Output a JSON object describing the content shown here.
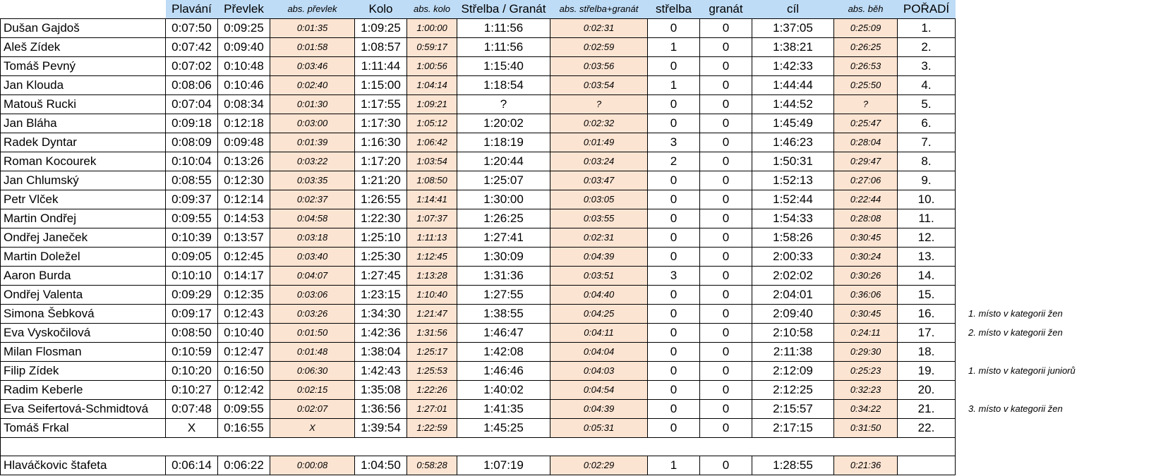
{
  "headers": [
    "",
    "Plavání",
    "Převlek",
    "abs. převlek",
    "Kolo",
    "abs. kolo",
    "Střelba / Granát",
    "abs. střelba+granát",
    "střelba",
    "granát",
    "cíl",
    "abs. běh",
    "POŘADÍ"
  ],
  "rows": [
    {
      "cells": [
        "Dušan Gajdoš",
        "0:07:50",
        "0:09:25",
        "0:01:35",
        "1:09:25",
        "1:00:00",
        "1:11:56",
        "0:02:31",
        "0",
        "0",
        "1:37:05",
        "0:25:09",
        "1."
      ],
      "note": ""
    },
    {
      "cells": [
        "Aleš Zídek",
        "0:07:42",
        "0:09:40",
        "0:01:58",
        "1:08:57",
        "0:59:17",
        "1:11:56",
        "0:02:59",
        "1",
        "0",
        "1:38:21",
        "0:26:25",
        "2."
      ],
      "note": ""
    },
    {
      "cells": [
        "Tomáš Pevný",
        "0:07:02",
        "0:10:48",
        "0:03:46",
        "1:11:44",
        "1:00:56",
        "1:15:40",
        "0:03:56",
        "0",
        "0",
        "1:42:33",
        "0:26:53",
        "3."
      ],
      "note": ""
    },
    {
      "cells": [
        "Jan Klouda",
        "0:08:06",
        "0:10:46",
        "0:02:40",
        "1:15:00",
        "1:04:14",
        "1:18:54",
        "0:03:54",
        "1",
        "0",
        "1:44:44",
        "0:25:50",
        "4."
      ],
      "note": ""
    },
    {
      "cells": [
        "Matouš Rucki",
        "0:07:04",
        "0:08:34",
        "0:01:30",
        "1:17:55",
        "1:09:21",
        "?",
        "?",
        "0",
        "0",
        "1:44:52",
        "?",
        "5."
      ],
      "note": ""
    },
    {
      "cells": [
        "Jan Bláha",
        "0:09:18",
        "0:12:18",
        "0:03:00",
        "1:17:30",
        "1:05:12",
        "1:20:02",
        "0:02:32",
        "0",
        "0",
        "1:45:49",
        "0:25:47",
        "6."
      ],
      "note": ""
    },
    {
      "cells": [
        "Radek Dyntar",
        "0:08:09",
        "0:09:48",
        "0:01:39",
        "1:16:30",
        "1:06:42",
        "1:18:19",
        "0:01:49",
        "3",
        "0",
        "1:46:23",
        "0:28:04",
        "7."
      ],
      "note": ""
    },
    {
      "cells": [
        "Roman Kocourek",
        "0:10:04",
        "0:13:26",
        "0:03:22",
        "1:17:20",
        "1:03:54",
        "1:20:44",
        "0:03:24",
        "2",
        "0",
        "1:50:31",
        "0:29:47",
        "8."
      ],
      "note": ""
    },
    {
      "cells": [
        "Jan Chlumský",
        "0:08:55",
        "0:12:30",
        "0:03:35",
        "1:21:20",
        "1:08:50",
        "1:25:07",
        "0:03:47",
        "0",
        "0",
        "1:52:13",
        "0:27:06",
        "9."
      ],
      "note": ""
    },
    {
      "cells": [
        "Petr Vlček",
        "0:09:37",
        "0:12:14",
        "0:02:37",
        "1:26:55",
        "1:14:41",
        "1:30:00",
        "0:03:05",
        "0",
        "0",
        "1:52:44",
        "0:22:44",
        "10."
      ],
      "note": ""
    },
    {
      "cells": [
        "Martin Ondřej",
        "0:09:55",
        "0:14:53",
        "0:04:58",
        "1:22:30",
        "1:07:37",
        "1:26:25",
        "0:03:55",
        "0",
        "0",
        "1:54:33",
        "0:28:08",
        "11."
      ],
      "note": ""
    },
    {
      "cells": [
        "Ondřej Janeček",
        "0:10:39",
        "0:13:57",
        "0:03:18",
        "1:25:10",
        "1:11:13",
        "1:27:41",
        "0:02:31",
        "0",
        "0",
        "1:58:26",
        "0:30:45",
        "12."
      ],
      "note": ""
    },
    {
      "cells": [
        "Martin Doležel",
        "0:09:05",
        "0:12:45",
        "0:03:40",
        "1:25:30",
        "1:12:45",
        "1:30:09",
        "0:04:39",
        "0",
        "0",
        "2:00:33",
        "0:30:24",
        "13."
      ],
      "note": ""
    },
    {
      "cells": [
        "Aaron Burda",
        "0:10:10",
        "0:14:17",
        "0:04:07",
        "1:27:45",
        "1:13:28",
        "1:31:36",
        "0:03:51",
        "3",
        "0",
        "2:02:02",
        "0:30:26",
        "14."
      ],
      "note": ""
    },
    {
      "cells": [
        "Ondřej Valenta",
        "0:09:29",
        "0:12:35",
        "0:03:06",
        "1:23:15",
        "1:10:40",
        "1:27:55",
        "0:04:40",
        "0",
        "0",
        "2:04:01",
        "0:36:06",
        "15."
      ],
      "note": ""
    },
    {
      "cells": [
        "Simona Šebková",
        "0:09:17",
        "0:12:43",
        "0:03:26",
        "1:34:30",
        "1:21:47",
        "1:38:55",
        "0:04:25",
        "0",
        "0",
        "2:09:40",
        "0:30:45",
        "16."
      ],
      "note": "1. místo v kategorii žen"
    },
    {
      "cells": [
        "Eva Vyskočilová",
        "0:08:50",
        "0:10:40",
        "0:01:50",
        "1:42:36",
        "1:31:56",
        "1:46:47",
        "0:04:11",
        "0",
        "0",
        "2:10:58",
        "0:24:11",
        "17."
      ],
      "note": "2. místo v kategorii žen"
    },
    {
      "cells": [
        "Milan Flosman",
        "0:10:59",
        "0:12:47",
        "0:01:48",
        "1:38:04",
        "1:25:17",
        "1:42:08",
        "0:04:04",
        "0",
        "0",
        "2:11:38",
        "0:29:30",
        "18."
      ],
      "note": ""
    },
    {
      "cells": [
        "Filip Zídek",
        "0:10:20",
        "0:16:50",
        "0:06:30",
        "1:42:43",
        "1:25:53",
        "1:46:46",
        "0:04:03",
        "0",
        "0",
        "2:12:09",
        "0:25:23",
        "19."
      ],
      "note": "1. místo v kategorii juniorů"
    },
    {
      "cells": [
        "Radim Keberle",
        "0:10:27",
        "0:12:42",
        "0:02:15",
        "1:35:08",
        "1:22:26",
        "1:40:02",
        "0:04:54",
        "0",
        "0",
        "2:12:25",
        "0:32:23",
        "20."
      ],
      "note": ""
    },
    {
      "cells": [
        "Eva Seifertová-Schmidtová",
        "0:07:48",
        "0:09:55",
        "0:02:07",
        "1:36:56",
        "1:27:01",
        "1:41:35",
        "0:04:39",
        "0",
        "0",
        "2:15:57",
        "0:34:22",
        "21."
      ],
      "note": "3. místo v kategorii žen"
    },
    {
      "cells": [
        "Tomáš Frkal",
        "X",
        "0:16:55",
        "X",
        "1:39:54",
        "1:22:59",
        "1:45:25",
        "0:05:31",
        "0",
        "0",
        "2:17:15",
        "0:31:50",
        "22."
      ],
      "note": ""
    }
  ],
  "relay": {
    "cells": [
      "Hlaváčkovic štafeta",
      "0:06:14",
      "0:06:22",
      "0:00:08",
      "1:04:50",
      "0:58:28",
      "1:07:19",
      "0:02:29",
      "1",
      "0",
      "1:28:55",
      "0:21:36",
      ""
    ]
  }
}
